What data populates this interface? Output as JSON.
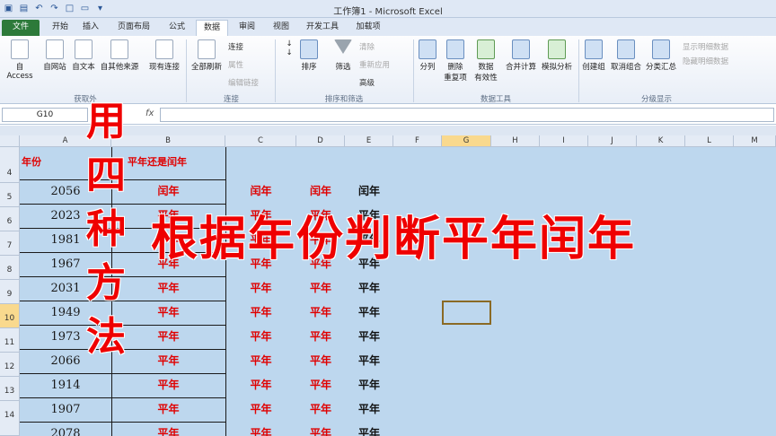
{
  "titlebar": {
    "title": "工作簿1 - Microsoft Excel"
  },
  "tabs": [
    {
      "label": "文件"
    },
    {
      "label": "开始"
    },
    {
      "label": "插入"
    },
    {
      "label": "页面布局"
    },
    {
      "label": "公式"
    },
    {
      "label": "数据"
    },
    {
      "label": "审阅"
    },
    {
      "label": "视图"
    },
    {
      "label": "开发工具"
    },
    {
      "label": "加载项"
    }
  ],
  "ribbon": {
    "buttons": [
      "自 Access",
      "自网站",
      "自文本",
      "自其他来源",
      "现有连接",
      "全部刷新",
      "排序",
      "筛选",
      "分列",
      "删除",
      "重复项",
      "数据",
      "有效性",
      "合并计算",
      "模拟分析",
      "创建组",
      "取消组合",
      "分类汇总"
    ],
    "small": [
      "连接",
      "属性",
      "编辑链接",
      "清除",
      "重新应用",
      "高级",
      "显示明细数据",
      "隐藏明细数据"
    ],
    "groups": [
      "获取外",
      "连接",
      "排序和筛选",
      "数据工具",
      "分级显示"
    ]
  },
  "formula_bar": {
    "name_box": "G10",
    "fx": "fx",
    "value": ""
  },
  "columns": [
    "A",
    "B",
    "C",
    "D",
    "E",
    "F",
    "G",
    "H",
    "I",
    "J",
    "K",
    "L",
    "M"
  ],
  "rows": [
    "4",
    "5",
    "6",
    "7",
    "8",
    "9",
    "10",
    "11",
    "12",
    "13",
    "14"
  ],
  "headers": {
    "a": "年份",
    "b": "平年还是闰年"
  },
  "data_rows": [
    {
      "year": "2056",
      "b": "闰年",
      "c": "闰年",
      "d": "闰年",
      "e": "闰年"
    },
    {
      "year": "2023",
      "b": "平年",
      "c": "平年",
      "d": "平年",
      "e": "平年"
    },
    {
      "year": "1981",
      "b": "平年",
      "c": "平年",
      "d": "平年",
      "e": "平年"
    },
    {
      "year": "1967",
      "b": "平年",
      "c": "平年",
      "d": "平年",
      "e": "平年"
    },
    {
      "year": "2031",
      "b": "平年",
      "c": "平年",
      "d": "平年",
      "e": "平年"
    },
    {
      "year": "1949",
      "b": "平年",
      "c": "平年",
      "d": "平年",
      "e": "平年"
    },
    {
      "year": "1973",
      "b": "平年",
      "c": "平年",
      "d": "平年",
      "e": "平年"
    },
    {
      "year": "2066",
      "b": "平年",
      "c": "平年",
      "d": "平年",
      "e": "平年"
    },
    {
      "year": "1914",
      "b": "平年",
      "c": "平年",
      "d": "平年",
      "e": "平年"
    },
    {
      "year": "1907",
      "b": "平年",
      "c": "平年",
      "d": "平年",
      "e": "平年"
    },
    {
      "year": "2078",
      "b": "平年",
      "c": "平年",
      "d": "平年",
      "e": "平年"
    }
  ],
  "overlay": {
    "vertical": [
      "用",
      "四",
      "种",
      "方",
      "法"
    ],
    "horizontal": "根据年份判断平年闰年"
  },
  "colors": {
    "accent_red": "#e00000",
    "sheet_fill": "#bdd7ee",
    "file_tab": "#2d7a3a"
  }
}
